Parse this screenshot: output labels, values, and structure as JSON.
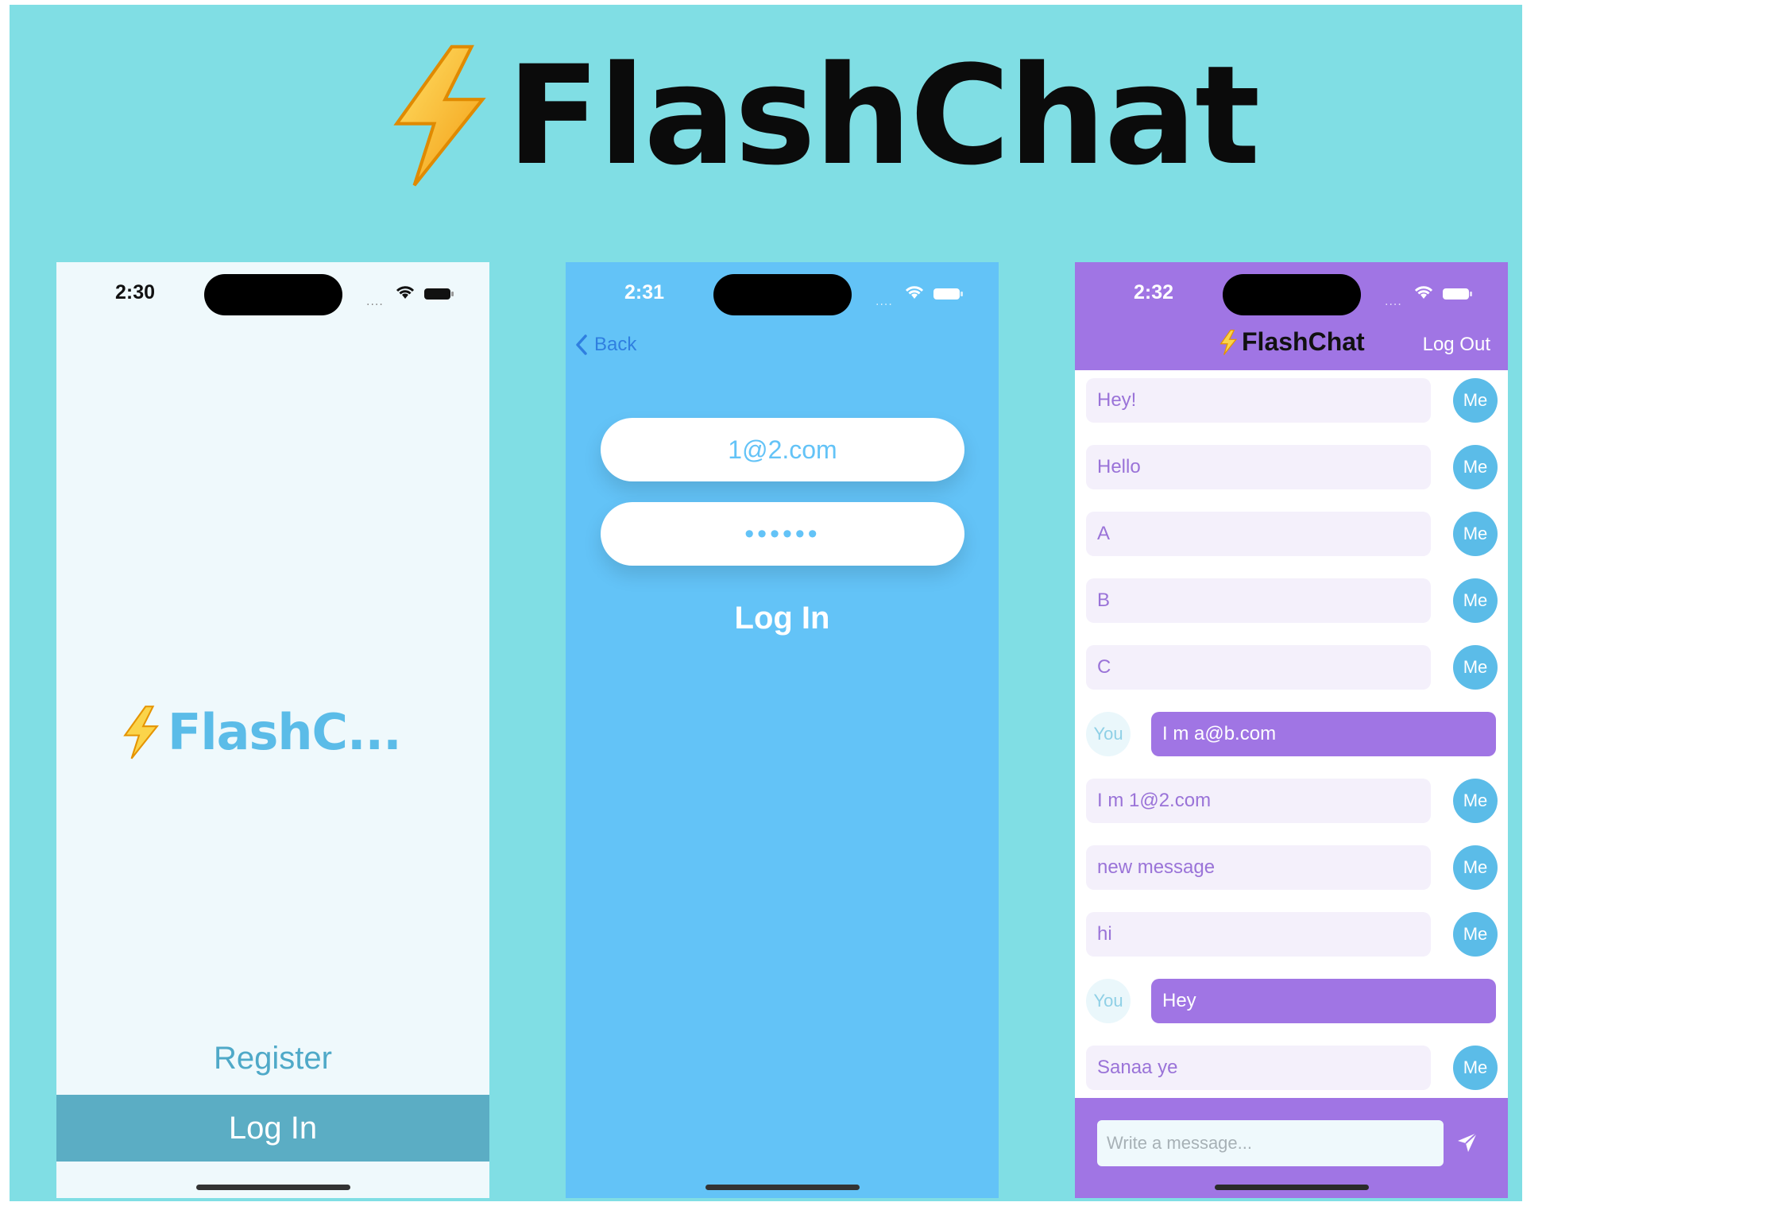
{
  "colors": {
    "banner_bg": "#80dee4",
    "phone1_bg": "#eff9fc",
    "phone2_bg": "#63c3f7",
    "chat_purple": "#a075e4",
    "accent_blue": "#5bbce8"
  },
  "banner": {
    "title": "FlashChat",
    "logo_icon": "lightning-bolt-icon"
  },
  "welcome_screen": {
    "time": "2:30",
    "signal": "....",
    "logo_text": "FlashC...",
    "register_label": "Register",
    "login_label": "Log In"
  },
  "login_screen": {
    "time": "2:31",
    "signal": "....",
    "back_label": "Back",
    "email_value": "1@2.com",
    "password_value": "••••••",
    "login_label": "Log In"
  },
  "chat_screen": {
    "time": "2:32",
    "signal": "....",
    "nav_title": "FlashChat",
    "logout_label": "Log Out",
    "messages": [
      {
        "sender": "Me",
        "text": "Hey!"
      },
      {
        "sender": "Me",
        "text": "Hello"
      },
      {
        "sender": "Me",
        "text": "A"
      },
      {
        "sender": "Me",
        "text": "B"
      },
      {
        "sender": "Me",
        "text": "C"
      },
      {
        "sender": "You",
        "text": "I m a@b.com"
      },
      {
        "sender": "Me",
        "text": "I m 1@2.com"
      },
      {
        "sender": "Me",
        "text": "new message"
      },
      {
        "sender": "Me",
        "text": "hi"
      },
      {
        "sender": "You",
        "text": "Hey"
      },
      {
        "sender": "Me",
        "text": "Sanaa ye"
      }
    ],
    "input_placeholder": "Write a message...",
    "send_icon": "paper-plane-icon"
  }
}
